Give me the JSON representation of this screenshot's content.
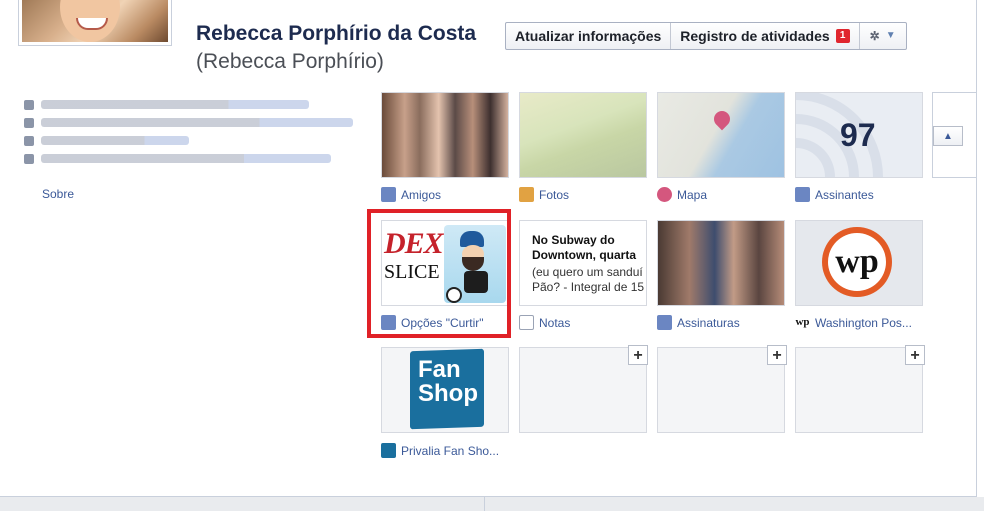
{
  "profile": {
    "name": "Rebecca Porphírio da Costa",
    "alternate_name": "(Rebecca Porphírio)"
  },
  "header_buttons": {
    "update_info": "Atualizar informações",
    "activity_log": "Registro de atividades",
    "activity_count": "1",
    "settings_icon": "gear-icon"
  },
  "about": {
    "link": "Sobre"
  },
  "tiles": {
    "friends": {
      "label": "Amigos",
      "icon": "friends-icon"
    },
    "photos": {
      "label": "Fotos",
      "icon": "photos-icon"
    },
    "map": {
      "label": "Mapa",
      "icon": "map-pin-icon"
    },
    "subscribers": {
      "label": "Assinantes",
      "icon": "subscribers-icon",
      "count": "97"
    },
    "likes": {
      "label": "Opções \"Curtir\"",
      "icon": "like-icon",
      "image_text_1": "DEX",
      "image_text_2": "SLICE"
    },
    "notes": {
      "label": "Notas",
      "icon": "notes-icon",
      "preview_title": "No Subway do Downtown, quarta",
      "preview_body": "(eu quero um sanduí Pão? - Integral de 15"
    },
    "subscriptions": {
      "label": "Assinaturas",
      "icon": "subscriptions-icon"
    },
    "washington_post": {
      "label": "Washington Pos...",
      "icon": "wp-icon",
      "logo": "wp"
    },
    "fan_shop": {
      "label": "Privalia Fan Sho...",
      "icon": "fan-shop-icon",
      "logo_line1": "Fan",
      "logo_line2": "Shop"
    }
  },
  "add_symbol": "+"
}
